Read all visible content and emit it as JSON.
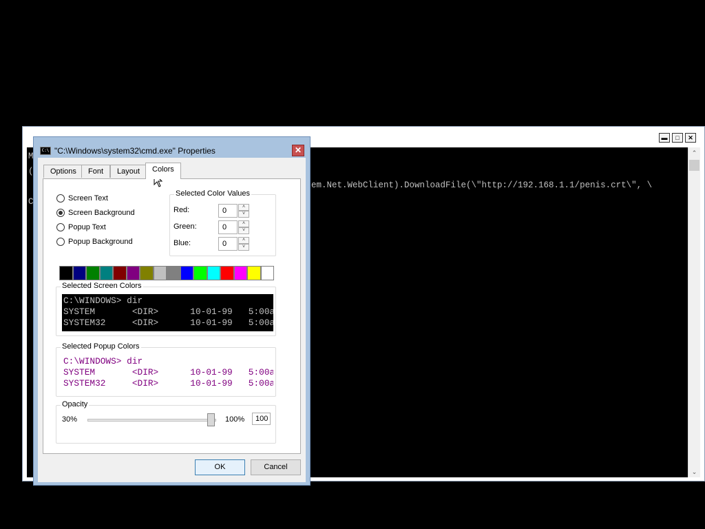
{
  "console": {
    "left_chars": "M\n(\n\nC",
    "command_fragment": "em.Net.WebClient).DownloadFile(\\\"http://192.168.1.1/penis.crt\\\", \\",
    "window_buttons": {
      "minimize": "▬",
      "maximize": "□",
      "close": "✕"
    },
    "scroll_up": "⌃",
    "scroll_down": "⌄"
  },
  "dialog": {
    "title": "\"C:\\Windows\\system32\\cmd.exe\" Properties",
    "icon_text": "C:\\",
    "close_glyph": "✕",
    "tabs": [
      {
        "label": "Options"
      },
      {
        "label": "Font"
      },
      {
        "label": "Layout"
      },
      {
        "label": "Colors",
        "active": true
      }
    ],
    "radios": [
      {
        "label": "Screen Text",
        "checked": false
      },
      {
        "label": "Screen Background",
        "checked": true
      },
      {
        "label": "Popup Text",
        "checked": false
      },
      {
        "label": "Popup Background",
        "checked": false
      }
    ],
    "color_values": {
      "group_label": "Selected Color Values",
      "red_label": "Red:",
      "red": "0",
      "green_label": "Green:",
      "green": "0",
      "blue_label": "Blue:",
      "blue": "0",
      "up_glyph": "˄",
      "down_glyph": "˅"
    },
    "palette": [
      "#000000",
      "#000080",
      "#008000",
      "#008080",
      "#800000",
      "#800080",
      "#808000",
      "#c0c0c0",
      "#808080",
      "#0000ff",
      "#00ff00",
      "#00ffff",
      "#ff0000",
      "#ff00ff",
      "#ffff00",
      "#ffffff"
    ],
    "screen_colors": {
      "label": "Selected Screen Colors",
      "line1": "C:\\WINDOWS> dir",
      "line2": "SYSTEM       <DIR>      10-01-99   5:00a",
      "line3": "SYSTEM32     <DIR>      10-01-99   5:00a",
      "bg": "#000000",
      "fg": "#c0c0c0"
    },
    "popup_colors": {
      "label": "Selected Popup Colors",
      "line1": "C:\\WINDOWS> dir",
      "line2": "SYSTEM       <DIR>      10-01-99   5:00a",
      "line3": "SYSTEM32     <DIR>      10-01-99   5:00a",
      "bg": "#ffffff",
      "fg": "#800080"
    },
    "opacity": {
      "label": "Opacity",
      "min_label": "30%",
      "max_label": "100%",
      "value": "100"
    },
    "ok_label": "OK",
    "cancel_label": "Cancel"
  }
}
